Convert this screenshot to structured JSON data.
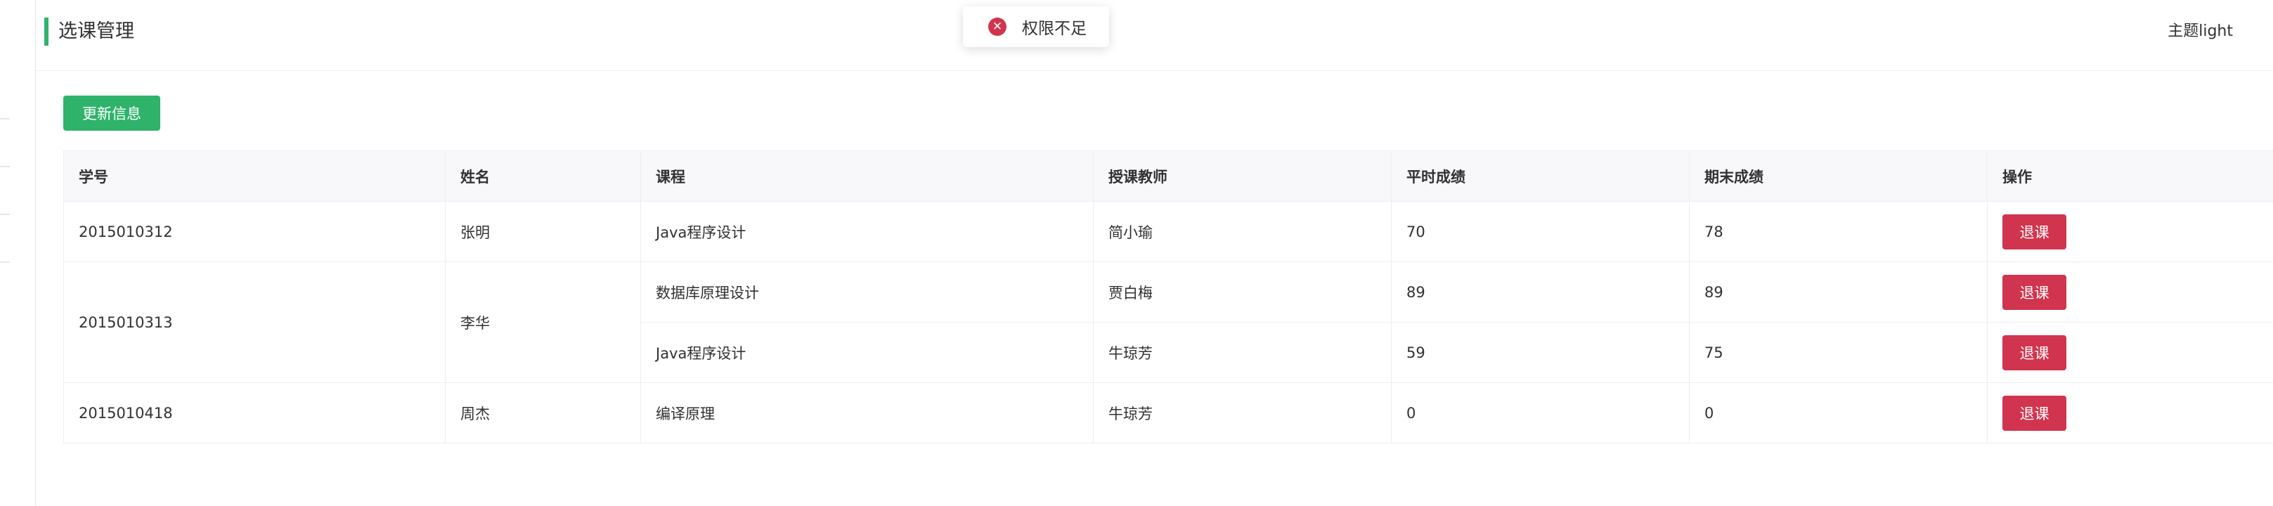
{
  "header": {
    "title": "选课管理",
    "theme_toggle": "主题light"
  },
  "toast": {
    "icon": "error-circle-icon",
    "message": "权限不足"
  },
  "toolbar": {
    "update_label": "更新信息"
  },
  "table": {
    "columns": [
      "学号",
      "姓名",
      "课程",
      "授课教师",
      "平时成绩",
      "期末成绩",
      "操作"
    ],
    "rows": [
      {
        "student_id": "2015010312",
        "name": "张明",
        "course": "Java程序设计",
        "teacher": "简小瑜",
        "usual_score": "70",
        "final_score": "78",
        "action": "退课"
      },
      {
        "student_id": "2015010313",
        "name": "李华",
        "course": "数据库原理设计",
        "teacher": "贾白梅",
        "usual_score": "89",
        "final_score": "89",
        "action": "退课"
      },
      {
        "student_id": "2015010313",
        "name": "李华",
        "course": "Java程序设计",
        "teacher": "牛琼芳",
        "usual_score": "59",
        "final_score": "75",
        "action": "退课"
      },
      {
        "student_id": "2015010418",
        "name": "周杰",
        "course": "编译原理",
        "teacher": "牛琼芳",
        "usual_score": "0",
        "final_score": "0",
        "action": "退课"
      }
    ]
  },
  "colors": {
    "primary": "#2fb36b",
    "danger": "#d1344e",
    "header_bg": "#f8f8fa",
    "border": "#ebeef5"
  }
}
